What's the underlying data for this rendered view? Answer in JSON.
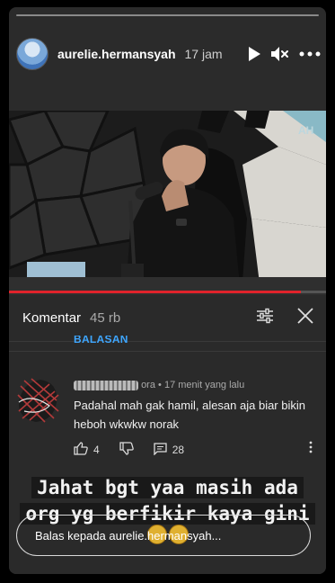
{
  "story": {
    "username": "aurelie.hermansyah",
    "time": "17 jam",
    "icons": [
      "play-icon",
      "mute-icon",
      "more-icon"
    ]
  },
  "video": {
    "watermark": "AH",
    "progress": 0.92
  },
  "comments_panel": {
    "title": "Komentar",
    "count": "45 rb",
    "replies_label": "BALASAN",
    "comment": {
      "author_suffix": "ora",
      "time": "17 menit yang lalu",
      "text": "Padahal mah gak hamil, alesan aja biar bikin heboh wkwkw norak",
      "likes": "4",
      "replies": "28"
    }
  },
  "overlay": {
    "line1": "Jahat bgt yaa masih ada",
    "line2": "org yg berfikir kaya gini"
  },
  "reply_placeholder": "Balas kepada aurelie.hermansyah..."
}
